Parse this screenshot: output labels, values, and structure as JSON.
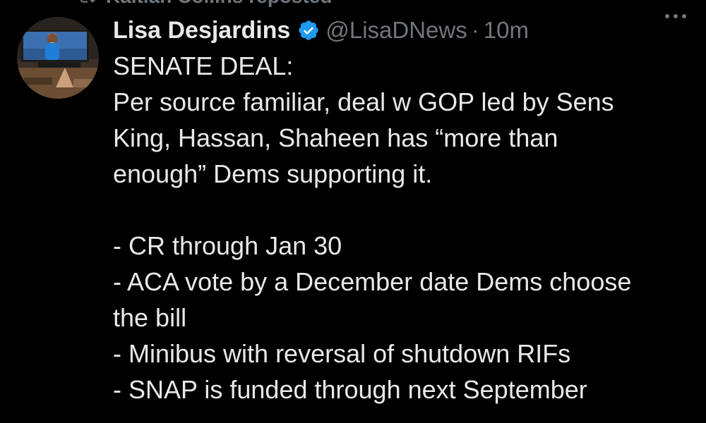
{
  "repost": {
    "label": "Kaitlan Collins reposted"
  },
  "tweet": {
    "author": {
      "display_name": "Lisa Desjardins",
      "handle": "@LisaDNews",
      "verified": true,
      "avatar": "avatar-photo"
    },
    "separator": "·",
    "timestamp": "10m",
    "more_icon": "more-horizontal-icon",
    "text": {
      "heading": "SENATE DEAL:",
      "paragraph_lines": [
        "Per source familiar,  deal w GOP led by Sens",
        "King, Hassan, Shaheen has “more than",
        "enough” Dems supporting it."
      ],
      "list_lines": [
        "- CR through Jan 30",
        "- ACA vote by a December date Dems choose",
        "the bill",
        "- Minibus with reversal of shutdown RIFs",
        "- SNAP is funded through next September"
      ]
    }
  },
  "colors": {
    "background": "#000000",
    "primary_text": "#e7e9ea",
    "secondary_text": "#71767b",
    "verified_badge": "#1d9bf0"
  }
}
